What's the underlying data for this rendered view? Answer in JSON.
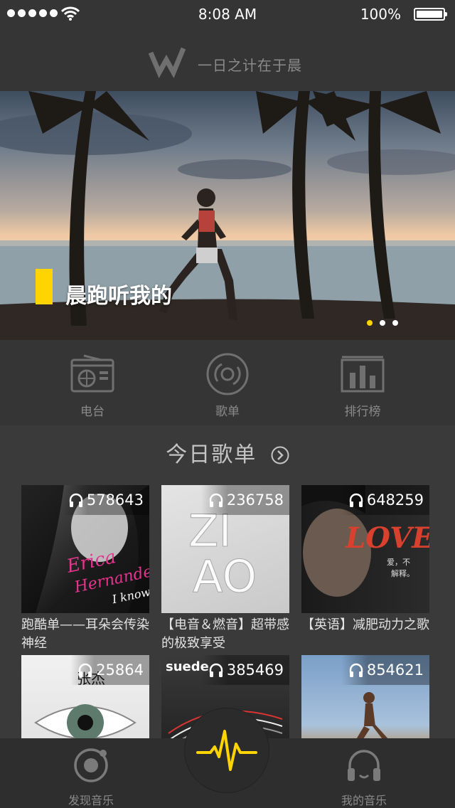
{
  "status_bar": {
    "time": "8:08 AM",
    "battery": "100%"
  },
  "header": {
    "title": "一日之计在于晨",
    "logo": "w-logo"
  },
  "banner": {
    "title": "晨跑听我的",
    "page_count": 3,
    "active_page": 1
  },
  "nav": [
    {
      "label": "电台",
      "icon": "radio-icon"
    },
    {
      "label": "歌单",
      "icon": "disc-icon"
    },
    {
      "label": "排行榜",
      "icon": "chart-icon"
    }
  ],
  "section": {
    "title": "今日歌单"
  },
  "playlists": [
    {
      "count": "578643",
      "title": "跑酷单——耳朵会传染神经",
      "cover_text": "Erica Hernandez I Know"
    },
    {
      "count": "236758",
      "title": "【电音＆燃音】超带感的极致享受",
      "cover_text": "ZI AO"
    },
    {
      "count": "648259",
      "title": "【英语】减肥动力之歌",
      "cover_text": "LOVE"
    },
    {
      "count": "25864",
      "title": "",
      "cover_text": "张杰"
    },
    {
      "count": "385469",
      "title": "",
      "cover_text": "suede"
    },
    {
      "count": "854621",
      "title": "",
      "cover_text": ""
    }
  ],
  "tabbar": {
    "discover": {
      "label": "发现音乐",
      "icon": "discover-icon"
    },
    "center": {
      "icon": "pulse-icon"
    },
    "mine": {
      "label": "我的音乐",
      "icon": "headphones-icon"
    }
  },
  "colors": {
    "accent": "#ffd400",
    "background": "#3a3a3a",
    "bar": "#353535"
  }
}
